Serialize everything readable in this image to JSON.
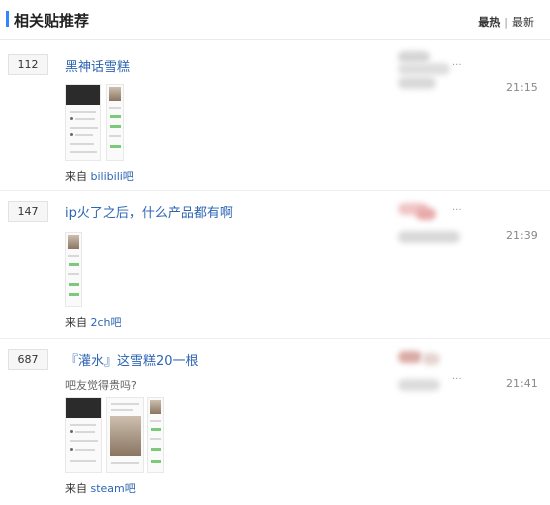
{
  "section": {
    "title": "相关贴推荐",
    "tabs": [
      {
        "label": "最热",
        "active": true
      },
      {
        "label": "最新",
        "active": false
      }
    ],
    "separator": "|"
  },
  "posts": [
    {
      "reply_count": "112",
      "title": "黑神话雪糕",
      "abstract": "",
      "source_prefix": "来自",
      "forum": "bilibili吧",
      "time": "21:15",
      "dots": "..."
    },
    {
      "reply_count": "147",
      "title": "ip火了之后，什么产品都有啊",
      "abstract": "",
      "source_prefix": "来自",
      "forum": "2ch吧",
      "time": "21:39",
      "dots": "..."
    },
    {
      "reply_count": "687",
      "title": "『灌水』这雪糕20一根",
      "abstract": "吧友觉得贵吗?",
      "source_prefix": "来自",
      "forum": "steam吧",
      "time": "21:41",
      "dots": "..."
    }
  ],
  "colors": {
    "accent": "#3385ff",
    "link": "#2d64b3",
    "green_bubble": "#7dc97a"
  }
}
